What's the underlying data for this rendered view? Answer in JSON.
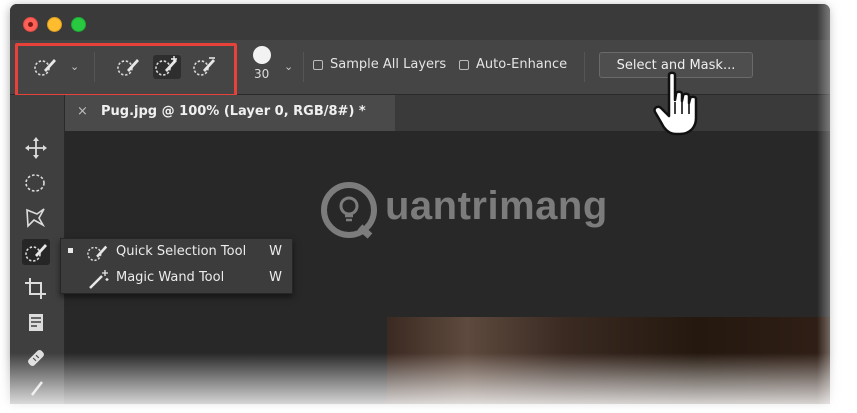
{
  "options_bar": {
    "brush_size": "30",
    "sample_all_layers_label": "Sample All Layers",
    "auto_enhance_label": "Auto-Enhance",
    "select_and_mask_label": "Select and Mask..."
  },
  "document_tab": {
    "close_glyph": "×",
    "title": "Pug.jpg @ 100% (Layer 0, RGB/8#) *"
  },
  "watermark": {
    "text": "uantrimang"
  },
  "flyout": {
    "items": [
      {
        "label": "Quick Selection Tool",
        "shortcut": "W",
        "selected": true,
        "icon": "quick-selection-icon"
      },
      {
        "label": "Magic Wand Tool",
        "shortcut": "W",
        "selected": false,
        "icon": "magic-wand-icon"
      }
    ]
  },
  "colors": {
    "highlight": "#e8413a",
    "panel": "#454545",
    "canvas": "#282828"
  }
}
